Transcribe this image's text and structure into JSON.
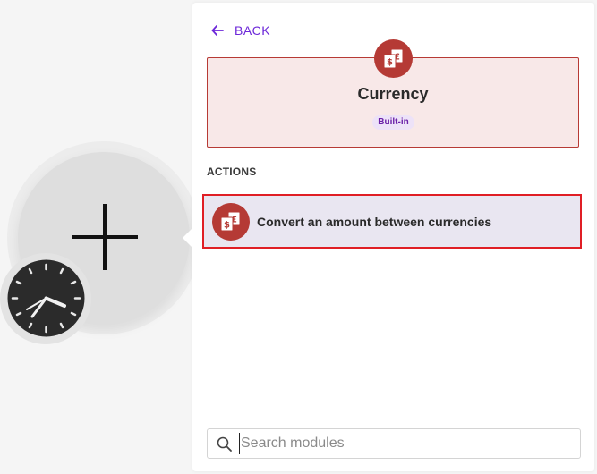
{
  "canvas": {
    "add_module_icon": "plus-icon",
    "trigger_icon": "clock-icon"
  },
  "panel": {
    "back_label": "BACK",
    "back_icon": "arrow-left-icon",
    "app": {
      "name": "Currency",
      "badge": "Built-in",
      "icon": "currency-exchange-icon",
      "color": "#b53a35",
      "background": "#f8e8e8"
    },
    "actions_label": "ACTIONS",
    "actions": [
      {
        "label": "Convert an amount between currencies",
        "icon": "currency-exchange-icon",
        "highlighted": true
      }
    ],
    "search": {
      "placeholder": "Search modules",
      "value": ""
    }
  },
  "colors": {
    "accent": "#6d28d9",
    "brand": "#b53a35",
    "highlight_border": "#e01e25"
  }
}
